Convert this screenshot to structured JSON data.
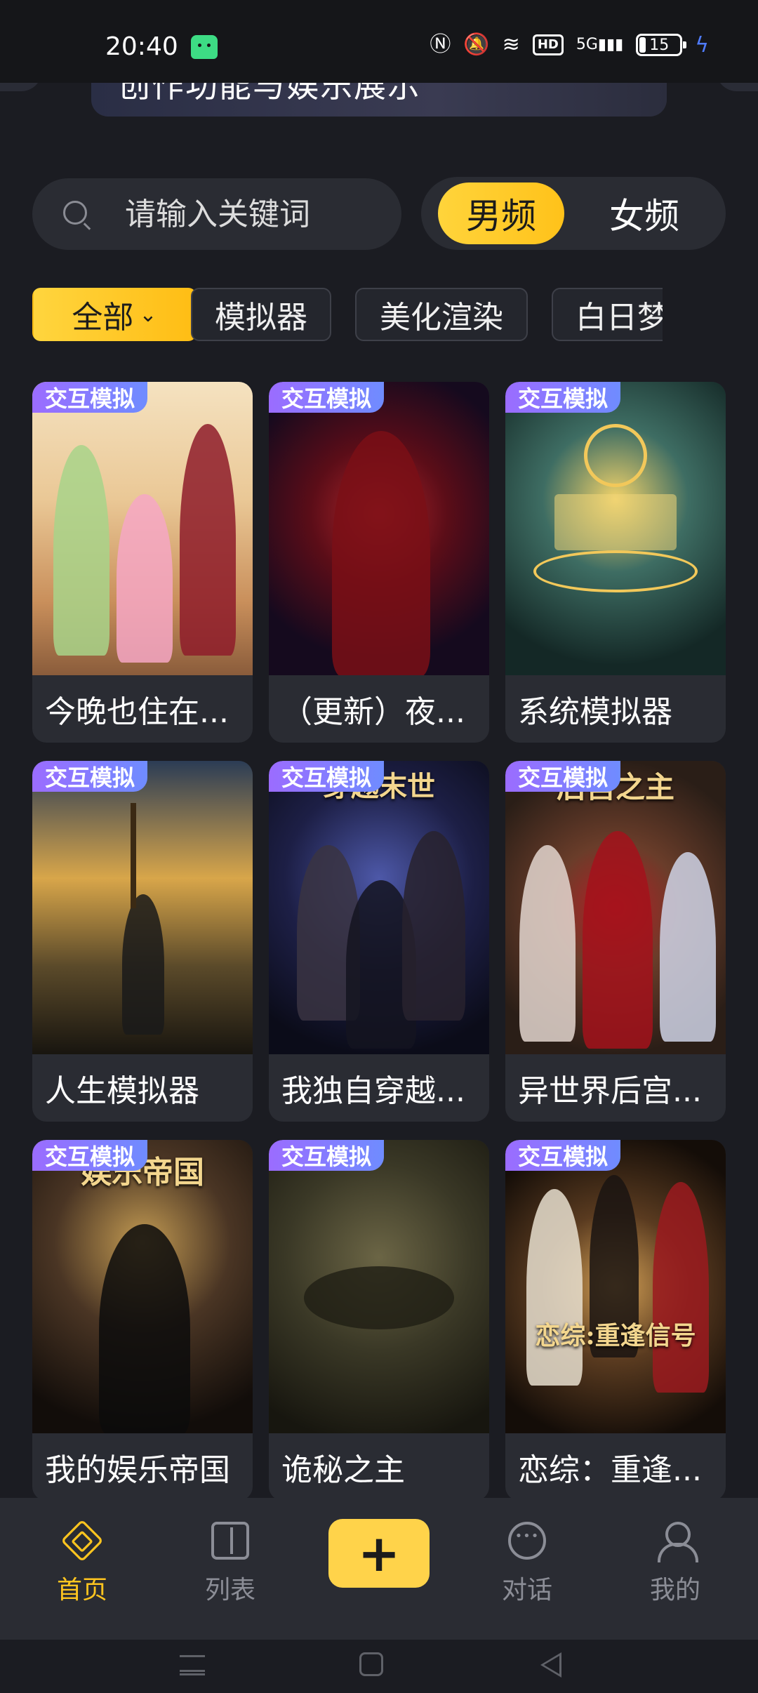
{
  "status_bar": {
    "time": "20:40",
    "network": "5G",
    "hd_label": "HD",
    "battery_level": "15",
    "icons": [
      "android-icon",
      "nfc-icon",
      "mute-icon",
      "wifi-icon",
      "hd-icon",
      "signal-icon",
      "battery-icon",
      "charging-icon"
    ]
  },
  "banner": {
    "text": "创作功能与娱乐展示"
  },
  "search": {
    "placeholder": "请输入关键词",
    "value": ""
  },
  "gender_tabs": [
    {
      "label": "男频",
      "active": true
    },
    {
      "label": "女频",
      "active": false
    }
  ],
  "categories": [
    {
      "label": "全部",
      "active": true
    },
    {
      "label": "模拟器",
      "active": false
    },
    {
      "label": "美化渲染",
      "active": false
    },
    {
      "label": "白日梦",
      "active": false
    }
  ],
  "cards": [
    {
      "tag": "交互模拟",
      "title": "今晚也住在...",
      "art_text": ""
    },
    {
      "tag": "交互模拟",
      "title": "（更新）夜...",
      "art_text": ""
    },
    {
      "tag": "交互模拟",
      "title": "系统模拟器",
      "art_text": ""
    },
    {
      "tag": "交互模拟",
      "title": "人生模拟器",
      "art_text": ""
    },
    {
      "tag": "交互模拟",
      "title": "我独自穿越...",
      "art_text": "穿越末世"
    },
    {
      "tag": "交互模拟",
      "title": "异世界后宫...",
      "art_text": "后宫之主"
    },
    {
      "tag": "交互模拟",
      "title": "我的娱乐帝国",
      "art_text": "娱乐帝国"
    },
    {
      "tag": "交互模拟",
      "title": "诡秘之主",
      "art_text": ""
    },
    {
      "tag": "交互模拟",
      "title": "恋综：重逢...",
      "art_text": "恋综:重逢信号"
    }
  ],
  "bottom_nav": {
    "home": "首页",
    "list": "列表",
    "add": "+",
    "chat": "对话",
    "me": "我的"
  },
  "colors": {
    "accent": "#ffc51f",
    "background": "#1b1c22",
    "card": "#2a2c33",
    "tag_gradient_start": "#9b6cff",
    "tag_gradient_end": "#6f8cff"
  }
}
